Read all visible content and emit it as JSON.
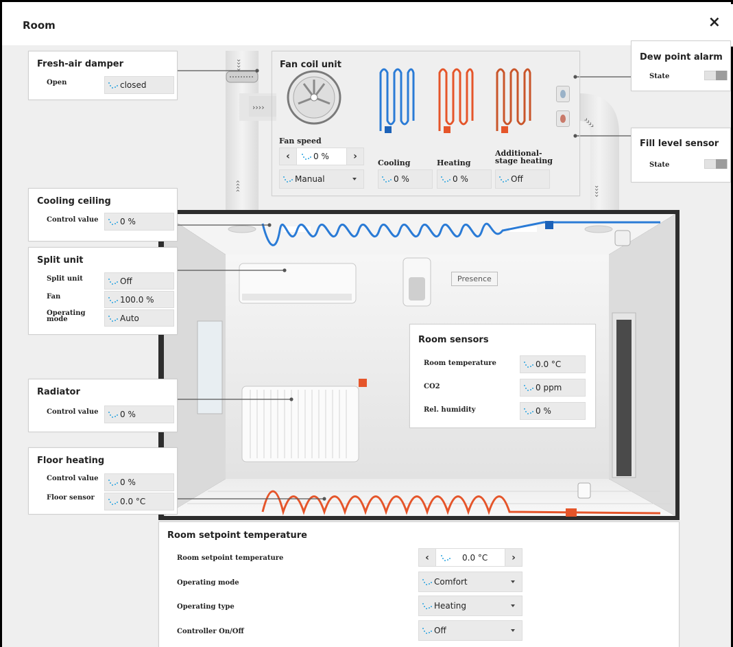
{
  "window": {
    "title": "Room",
    "close_icon": "×"
  },
  "fresh_air_damper": {
    "title": "Fresh-air damper",
    "open_label": "Open",
    "open_value": "closed"
  },
  "fan_coil_unit": {
    "title": "Fan coil unit",
    "fan_speed_label": "Fan speed",
    "fan_speed_value": "0 %",
    "fan_mode": "Manual",
    "cooling_label": "Cooling",
    "cooling_value": "0 %",
    "heating_label": "Heating",
    "heating_value": "0 %",
    "additional_label_1": "Additional-",
    "additional_label_2": "stage heating",
    "additional_value": "Off"
  },
  "dew_point_alarm": {
    "title": "Dew point alarm",
    "state_label": "State"
  },
  "fill_level_sensor": {
    "title": "Fill level sensor",
    "state_label": "State"
  },
  "cooling_ceiling": {
    "title": "Cooling ceiling",
    "control_label": "Control value",
    "control_value": "0 %"
  },
  "split_unit": {
    "title": "Split unit",
    "unit_label": "Split unit",
    "unit_value": "Off",
    "fan_label": "Fan",
    "fan_value": "100.0 %",
    "mode_label_1": "Operating",
    "mode_label_2": "mode",
    "mode_value": "Auto"
  },
  "radiator": {
    "title": "Radiator",
    "control_label": "Control value",
    "control_value": "0 %"
  },
  "floor_heating": {
    "title": "Floor heating",
    "control_label": "Control value",
    "control_value": "0 %",
    "sensor_label": "Floor sensor",
    "sensor_value": "0.0 °C"
  },
  "presence": {
    "label": "Presence"
  },
  "room_sensors": {
    "title": "Room sensors",
    "temp_label": "Room temperature",
    "temp_value": "0.0 °C",
    "co2_label": "CO2",
    "co2_value": "0 ppm",
    "humidity_label": "Rel. humidity",
    "humidity_value": "0 %"
  },
  "setpoint": {
    "title": "Room setpoint temperature",
    "setpoint_label": "Room setpoint temperature",
    "setpoint_value": "0.0 °C",
    "mode_label": "Operating mode",
    "mode_value": "Comfort",
    "type_label": "Operating type",
    "type_value": "Heating",
    "controller_label": "Controller On/Off",
    "controller_value": "Off"
  },
  "colors": {
    "cooling": "#2a7bd6",
    "heating": "#e5552a",
    "accent_dots": "#2aa3e0",
    "background": "#efefef"
  }
}
